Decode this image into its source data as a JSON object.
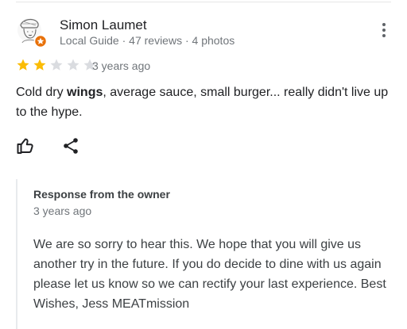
{
  "review": {
    "reviewer_name": "Simon Laumet",
    "reviewer_meta": "Local Guide · 47 reviews · 4 photos",
    "rating": 2,
    "rating_max": 5,
    "age": "3 years ago",
    "text_part1": "Cold dry ",
    "text_bold": "wings",
    "text_part2": ", average sauce, small burger... really didn't live up to the hype."
  },
  "owner_response": {
    "title": "Response from the owner",
    "age": "3 years ago",
    "text": "We are so sorry to hear this. We hope that you will give us another try in the future. If you do decide to dine with us again please let us know so we can rectify your last experience. Best Wishes, Jess MEATmission"
  },
  "colors": {
    "star_filled": "#fbbc04",
    "star_empty": "#dadce0",
    "badge": "#e8710a",
    "secondary_text": "#70757a"
  },
  "icons": [
    "avatar",
    "local-guide-badge-icon",
    "more-vert-icon",
    "star-icon",
    "thumb-up-icon",
    "share-icon"
  ]
}
